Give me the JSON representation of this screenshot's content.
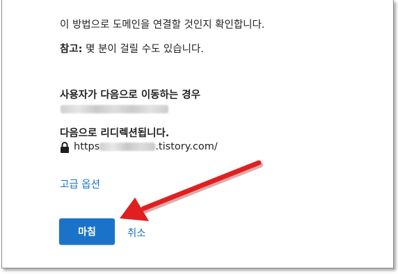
{
  "content": {
    "line1": "이 방법으로 도메인을 연결할 것인지 확인합니다.",
    "note_label": "참고:",
    "note_text": " 몇 분이 걸릴 수도 있습니다.",
    "redirect_from_heading": "사용자가 다음으로 이동하는 경우",
    "redirect_to_heading": "다음으로 리디렉션됩니다.",
    "url_prefix": "https",
    "url_suffix": ".tistory.com/",
    "advanced_options": "고급 옵션"
  },
  "actions": {
    "finish_label": "마침",
    "cancel_label": "취소"
  },
  "colors": {
    "accent": "#1a73c9",
    "annotation_arrow": "#e02020",
    "text": "#212121"
  },
  "icons": {
    "lock": "lock-icon"
  }
}
